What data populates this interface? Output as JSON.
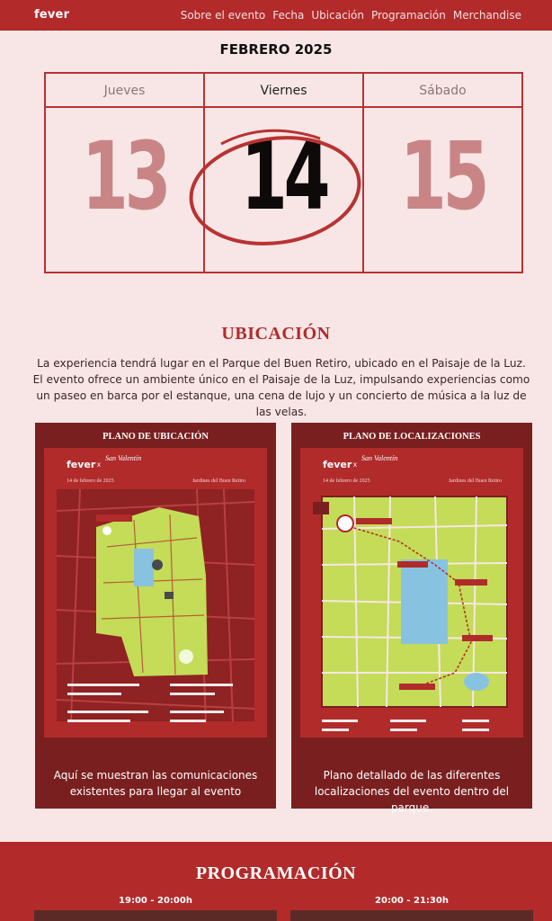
{
  "nav": {
    "logo": "fever",
    "links": [
      "Sobre el evento",
      "Fecha",
      "Ubicación",
      "Programación",
      "Merchandise"
    ]
  },
  "calendar": {
    "month": "FEBRERO 2025",
    "days": [
      {
        "name": "Jueves",
        "number": "13"
      },
      {
        "name": "Viernes",
        "number": "14"
      },
      {
        "name": "Sábado",
        "number": "15"
      }
    ]
  },
  "ubicacion": {
    "title": "UBICACIÓN",
    "description": "La experiencia tendrá lugar en el Parque del Buen Retiro, ubicado en el Paisaje de la Luz. El evento ofrece un ambiente único en el Paisaje de la Luz, impulsando experiencias como un paseo en barca por el estanque, una cena de lujo y un concierto de música a la luz de las velas.",
    "cards": [
      {
        "heading": "PLANO DE UBICACIÓN",
        "caption": "Aquí se muestran las comunicaciones existentes para llegar al evento",
        "map_brand": "fever",
        "map_x": "x",
        "map_script": "San Valentín",
        "map_date": "14 de febrero de 2025",
        "map_place": "Jardines del Buen Retiro"
      },
      {
        "heading": "PLANO DE LOCALIZACIONES",
        "caption": "Plano detallado de las diferentes localizaciones del evento dentro del parque.",
        "map_brand": "fever",
        "map_x": "x",
        "map_script": "San Valentín",
        "map_date": "14 de febrero de 2025",
        "map_place": "Jardines del Buen Retiro"
      }
    ]
  },
  "programacion": {
    "title": "PROGRAMACIÓN",
    "times": [
      "19:00 - 20:00h",
      "20:00 - 21:30h"
    ]
  },
  "colors": {
    "brand_red": "#b22a2a",
    "dark_red": "#7a1f1f",
    "background": "#f8e6e6",
    "park_green": "#c4dc58"
  }
}
